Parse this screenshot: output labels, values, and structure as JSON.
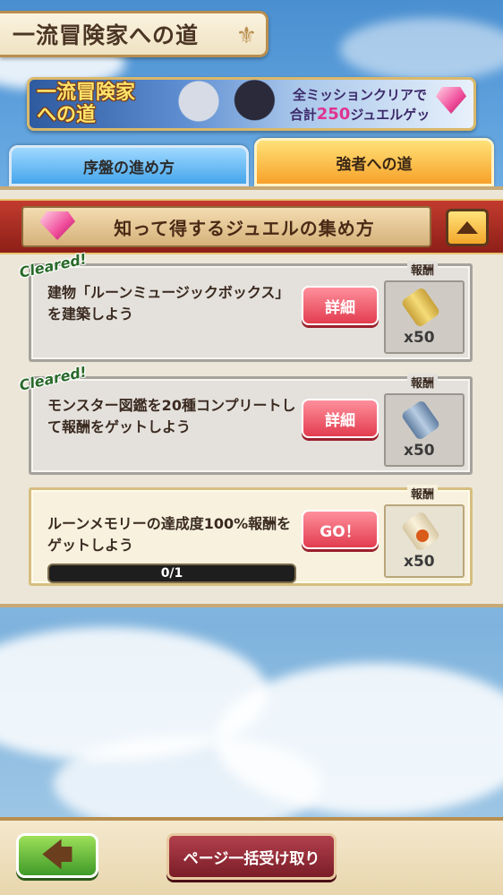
{
  "header": {
    "title": "一流冒険家への道"
  },
  "banner": {
    "logo_line1": "一流冒険家",
    "logo_line2": "への道",
    "text_line1": "全ミッションクリアで",
    "text_prefix": "合計",
    "text_amount": "250",
    "text_suffix": "ジュエルゲット！"
  },
  "tabs": [
    {
      "label": "序盤の進め方",
      "active": false
    },
    {
      "label": "強者への道",
      "active": true
    }
  ],
  "section": {
    "title": "知って得するジュエルの集め方"
  },
  "missions": [
    {
      "status": "Cleared!",
      "text": "建物「ルーンミュージックボックス」を建築しよう",
      "button": "詳細",
      "reward_label": "報酬",
      "reward_qty": "x50",
      "reward_icon": "gold-scroll-icon"
    },
    {
      "status": "Cleared!",
      "text": "モンスター図鑑を20種コンプリートして報酬をゲットしよう",
      "button": "詳細",
      "reward_label": "報酬",
      "reward_qty": "x50",
      "reward_icon": "blue-scroll-icon"
    },
    {
      "status": "",
      "text": "ルーンメモリーの達成度100%報酬をゲットしよう",
      "button": "GO！",
      "reward_label": "報酬",
      "reward_qty": "x50",
      "reward_icon": "paper-scroll-icon",
      "progress_text": "0/1",
      "progress": 0
    }
  ],
  "footer": {
    "back_icon": "back-arrow-icon",
    "claim_all": "ページ一括受け取り"
  },
  "colors": {
    "accent_red": "#8d1f18",
    "tab_active": "#f7a22a",
    "tab_inactive": "#45a5ec"
  }
}
